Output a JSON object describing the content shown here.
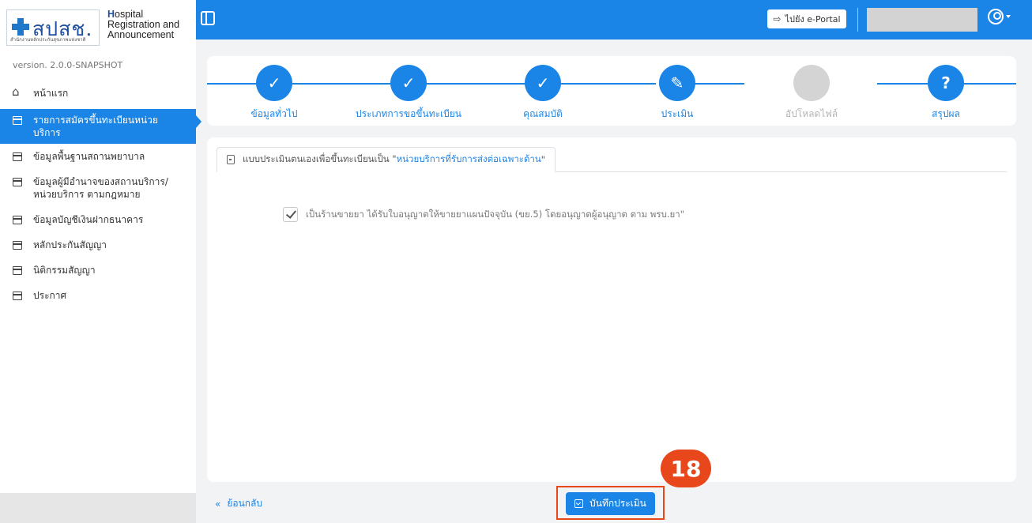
{
  "logo": {
    "mark": "สปสช.",
    "sub": "สำนักงานหลักประกันสุขภาพแห่งชาติ",
    "line1_first": "H",
    "line1_rest": "ospital",
    "line2": "Registration and",
    "line3": "Announcement"
  },
  "version": "version. 2.0.0-SNAPSHOT",
  "sidebar": {
    "items": [
      {
        "label": "หน้าแรก"
      },
      {
        "label": "รายการสมัครขึ้นทะเบียนหน่วยบริการ"
      },
      {
        "label": "ข้อมูลพื้นฐานสถานพยาบาล"
      },
      {
        "label": "ข้อมูลผู้มีอำนาจของสถานบริการ/ หน่วยบริการ ตามกฎหมาย"
      },
      {
        "label": "ข้อมูลบัญชีเงินฝากธนาคาร"
      },
      {
        "label": "หลักประกันสัญญา"
      },
      {
        "label": "นิติกรรมสัญญา"
      },
      {
        "label": "ประกาศ"
      }
    ]
  },
  "topbar": {
    "eportal_label": "ไปยัง e-Portal"
  },
  "stepper": {
    "steps": [
      {
        "label": "ข้อมูลทั่วไป",
        "symbol": "✓"
      },
      {
        "label": "ประเภทการขอขึ้นทะเบียน",
        "symbol": "✓"
      },
      {
        "label": "คุณสมบัติ",
        "symbol": "✓"
      },
      {
        "label": "ประเมิน",
        "symbol": "✎"
      },
      {
        "label": "อัปโหลดไฟล์",
        "symbol": ""
      },
      {
        "label": "สรุปผล",
        "symbol": "?"
      }
    ]
  },
  "assessment": {
    "tab_prefix": "แบบประเมินตนเองเพื่อขึ้นทะเบียนเป็น \"",
    "tab_highlight": "หน่วยบริการที่รับการส่งต่อเฉพาะด้าน",
    "tab_suffix": "\"",
    "checkbox_label": "เป็นร้านขายยา ได้รับใบอนุญาตให้ขายยาแผนปัจจุบัน (ขย.5) โดยอนุญาตผู้อนุญาต ตาม พรบ.ยา\"",
    "checkbox_checked": true
  },
  "footer": {
    "back_label": "ย้อนกลับ",
    "back_icon": "«",
    "save_label": "บันทึกประเมิน"
  },
  "annotation": {
    "badge": "18"
  },
  "colors": {
    "primary": "#1a85e6",
    "highlight": "#e8471b",
    "disabled": "#d4d4d4"
  }
}
